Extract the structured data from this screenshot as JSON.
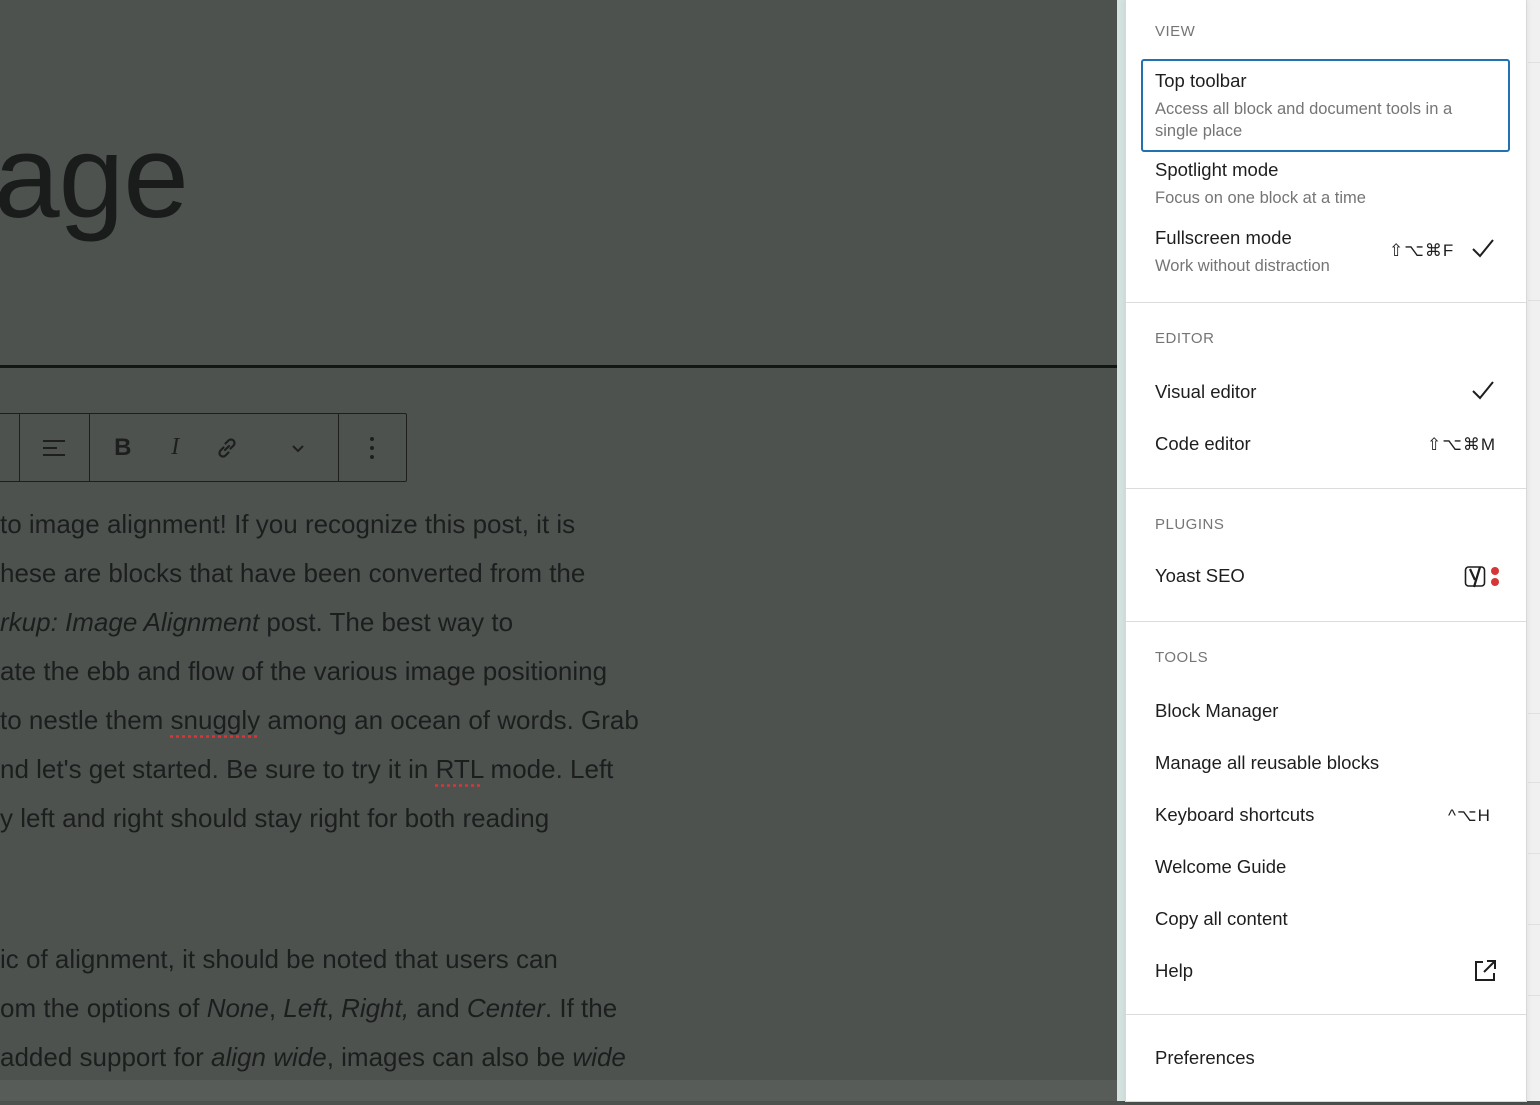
{
  "editor": {
    "title_fragment": "age",
    "paragraph1": {
      "l1": "to image alignment! If you recognize this post, it is",
      "l2": "hese are blocks that have been converted from the",
      "l3_em": "rkup: Image Alignment",
      "l3_rest": " post. The best way to",
      "l4": "ate the ebb and flow of the various image positioning",
      "l5_a": "to nestle them ",
      "l5_spell": "snuggly",
      "l5_b": " among an ocean of words. Grab",
      "l6_a": "nd let's get started. Be sure to try it in ",
      "l6_spell": "RTL",
      "l6_b": " mode. Left",
      "l7": "y left and right should stay right for both reading"
    },
    "paragraph2": {
      "l1": "ic of alignment, it should be noted that users can",
      "l2_a": "om the options of ",
      "l2_none": "None",
      "l2_c1": ", ",
      "l2_left": "Left",
      "l2_c2": ", ",
      "l2_right": "Right,",
      "l2_and": " and ",
      "l2_center": "Center",
      "l2_b": ". If the",
      "l3_a": " added support for ",
      "l3_em": "align wide",
      "l3_b": ", images can also be ",
      "l3_em2": "wide"
    },
    "toolbar_icons": [
      "align-left-icon",
      "bold-icon",
      "italic-icon",
      "link-icon",
      "chevron-down-icon",
      "more-options-icon"
    ],
    "toolbar_labels": {
      "bold": "B",
      "italic": "I"
    }
  },
  "menu": {
    "view": {
      "label": "VIEW",
      "items": [
        {
          "label": "Top toolbar",
          "desc": "Access all block and document tools in a single place",
          "selected": true
        },
        {
          "label": "Spotlight mode",
          "desc": "Focus on one block at a time"
        },
        {
          "label": "Fullscreen mode",
          "desc": "Work without distraction",
          "shortcut": "⇧⌥⌘F",
          "checked": true
        }
      ]
    },
    "editor": {
      "label": "EDITOR",
      "items": [
        {
          "label": "Visual editor",
          "checked": true
        },
        {
          "label": "Code editor",
          "shortcut": "⇧⌥⌘M"
        }
      ]
    },
    "plugins": {
      "label": "PLUGINS",
      "items": [
        {
          "label": "Yoast SEO",
          "icon": "yoast-icon"
        }
      ]
    },
    "tools": {
      "label": "TOOLS",
      "items": [
        {
          "label": "Block Manager"
        },
        {
          "label": "Manage all reusable blocks"
        },
        {
          "label": "Keyboard shortcuts",
          "shortcut": "^⌥H"
        },
        {
          "label": "Welcome Guide"
        },
        {
          "label": "Copy all content"
        },
        {
          "label": "Help",
          "icon": "external-link-icon"
        }
      ]
    },
    "preferences": {
      "label": "Preferences"
    }
  },
  "colors": {
    "overlay": "#4d524f",
    "focus_border": "#2271b1",
    "yoast_red": "#d63638"
  }
}
